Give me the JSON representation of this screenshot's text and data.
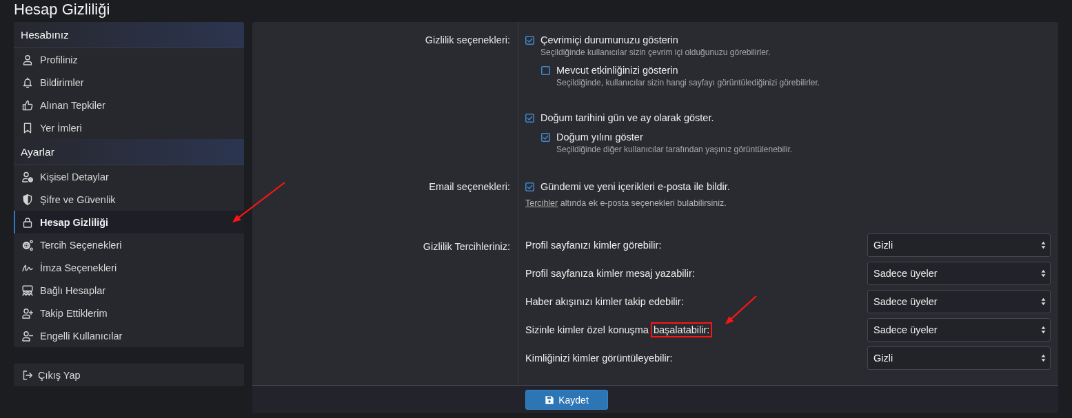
{
  "page_title": "Hesap Gizliliği",
  "sidebar": {
    "sections": [
      {
        "title": "Hesabınız",
        "items": [
          {
            "label": "Profiliniz",
            "selected": false
          },
          {
            "label": "Bildirimler",
            "selected": false
          },
          {
            "label": "Alınan Tepkiler",
            "selected": false
          },
          {
            "label": "Yer İmleri",
            "selected": false
          }
        ]
      },
      {
        "title": "Ayarlar",
        "items": [
          {
            "label": "Kişisel Detaylar",
            "selected": false
          },
          {
            "label": "Şifre ve Güvenlik",
            "selected": false
          },
          {
            "label": "Hesap Gizliliği",
            "selected": true
          },
          {
            "label": "Tercih Seçenekleri",
            "selected": false
          },
          {
            "label": "İmza Seçenekleri",
            "selected": false
          },
          {
            "label": "Bağlı Hesaplar",
            "selected": false
          },
          {
            "label": "Takip Ettiklerim",
            "selected": false
          },
          {
            "label": "Engelli Kullanıcılar",
            "selected": false
          }
        ]
      }
    ],
    "logout": "Çıkış Yap"
  },
  "form": {
    "groups": [
      {
        "label": "Gizlilik seçenekleri:",
        "kind": "checkboxes",
        "options": [
          {
            "label": "Çevrimiçi durumunuzu gösterin",
            "checked": true,
            "hint": "Seçildiğinde kullanıcılar sizin çevrim içi olduğunuzu görebilirler.",
            "children": [
              {
                "label": "Mevcut etkinliğinizi gösterin",
                "checked": false,
                "hint": "Seçildiğinde, kullanıcılar sizin hangi sayfayı görüntülediğinizi görebilirler."
              }
            ]
          },
          {
            "label": "Doğum tarihini gün ve ay olarak göster.",
            "checked": true,
            "children": [
              {
                "label": "Doğum yılını göster",
                "checked": true,
                "hint": "Seçildiğinde diğer kullanıcılar tarafından yaşınız görüntülenebilir."
              }
            ]
          }
        ]
      },
      {
        "label": "Email seçenekleri:",
        "kind": "checkboxes",
        "options": [
          {
            "label": "Gündemi ve yeni içerikleri e-posta ile bildir.",
            "checked": true
          }
        ],
        "note": {
          "link": "Tercihler",
          "text": "altında ek e-posta seçenekleri bulabilirsiniz."
        }
      },
      {
        "label": "Gizlilik Tercihleriniz:",
        "kind": "selects",
        "preferences": [
          {
            "label": "Profil sayfanızı kimler görebilir:",
            "value": "Gizli"
          },
          {
            "label": "Profil sayfanıza kimler mesaj yazabilir:",
            "value": "Sadece üyeler"
          },
          {
            "label": "Haber akışınızı kimler takip edebilir:",
            "value": "Sadece üyeler"
          },
          {
            "label": "Sizinle kimler özel konuşma",
            "highlighted": "başalatabilir:",
            "value": "Sadece üyeler"
          },
          {
            "label": "Kimliğinizi kimler görüntüleyebilir:",
            "value": "Gizli"
          }
        ]
      }
    ],
    "save_button": "Kaydet"
  }
}
